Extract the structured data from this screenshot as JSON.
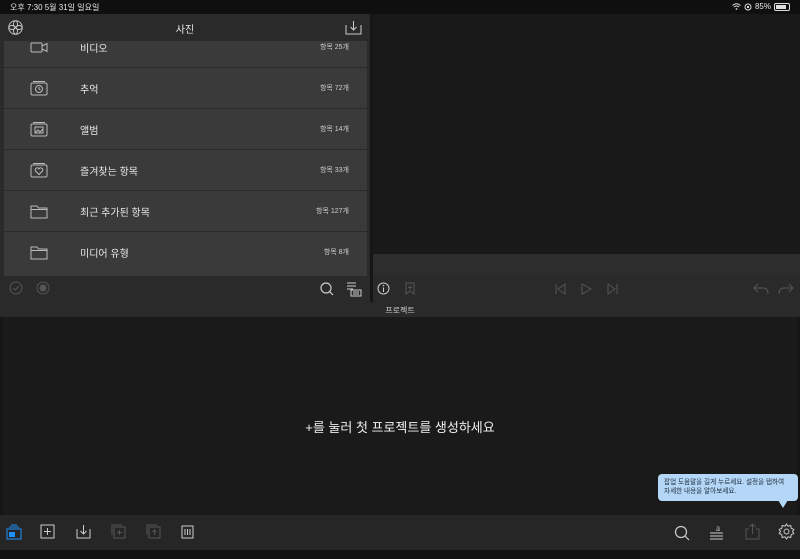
{
  "status_bar": {
    "time_date": "오후 7:30   5월 31일 일요일",
    "battery": "85%",
    "battery_level": 0.85
  },
  "photos": {
    "title": "사진",
    "items": [
      {
        "label": "비디오",
        "count": "항목 25개",
        "icon": "video-icon"
      },
      {
        "label": "추억",
        "count": "항목 72개",
        "icon": "memories-icon"
      },
      {
        "label": "앨범",
        "count": "항목 14개",
        "icon": "album-icon"
      },
      {
        "label": "즐겨찾는 항목",
        "count": "항목 33개",
        "icon": "heart-folder-icon"
      },
      {
        "label": "최근 추가된 항목",
        "count": "항목 127개",
        "icon": "folder-icon"
      },
      {
        "label": "미디어 유형",
        "count": "항목 8개",
        "icon": "folder-icon"
      }
    ]
  },
  "project": {
    "label": "프로젝트",
    "empty_message": "+를 눌러 첫 프로젝트를 생성하세요",
    "tooltip": "팝업 도움말을 길게 누르세요. 설정을 탭하여 자세한 내용을 알아보세요."
  },
  "colors": {
    "accent": "#1f8fff",
    "tooltip_bg": "#b5d7f7"
  }
}
